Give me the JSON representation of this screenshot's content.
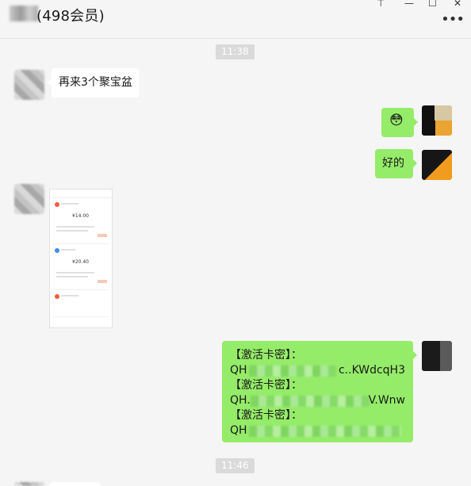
{
  "header": {
    "title": "(498会员)"
  },
  "window_controls": [
    "pin-icon",
    "minimize-icon",
    "maximize-icon",
    "close-icon"
  ],
  "colors": {
    "bubble_self": "#95ec69",
    "bubble_other": "#ffffff",
    "background": "#f5f5f5",
    "time_pill": "#dadada"
  },
  "chat": {
    "time1": "11:38",
    "msg_other_1": "再来3个聚宝盆",
    "msg_self_emoji": "😳",
    "msg_self_ok": "好的",
    "codes": [
      {
        "label": "【激活卡密】：",
        "prefix": "QH",
        "suffix": "c..KWdcqH3"
      },
      {
        "label": "【激活卡密】：",
        "prefix": "QH.",
        "suffix": "V.Wnw"
      },
      {
        "label": "【激活卡密】：",
        "prefix": "QH",
        "suffix": ""
      }
    ],
    "time2": "11:46"
  },
  "thumbnail": {
    "prices": [
      "¥14.00",
      "¥20.40"
    ]
  }
}
